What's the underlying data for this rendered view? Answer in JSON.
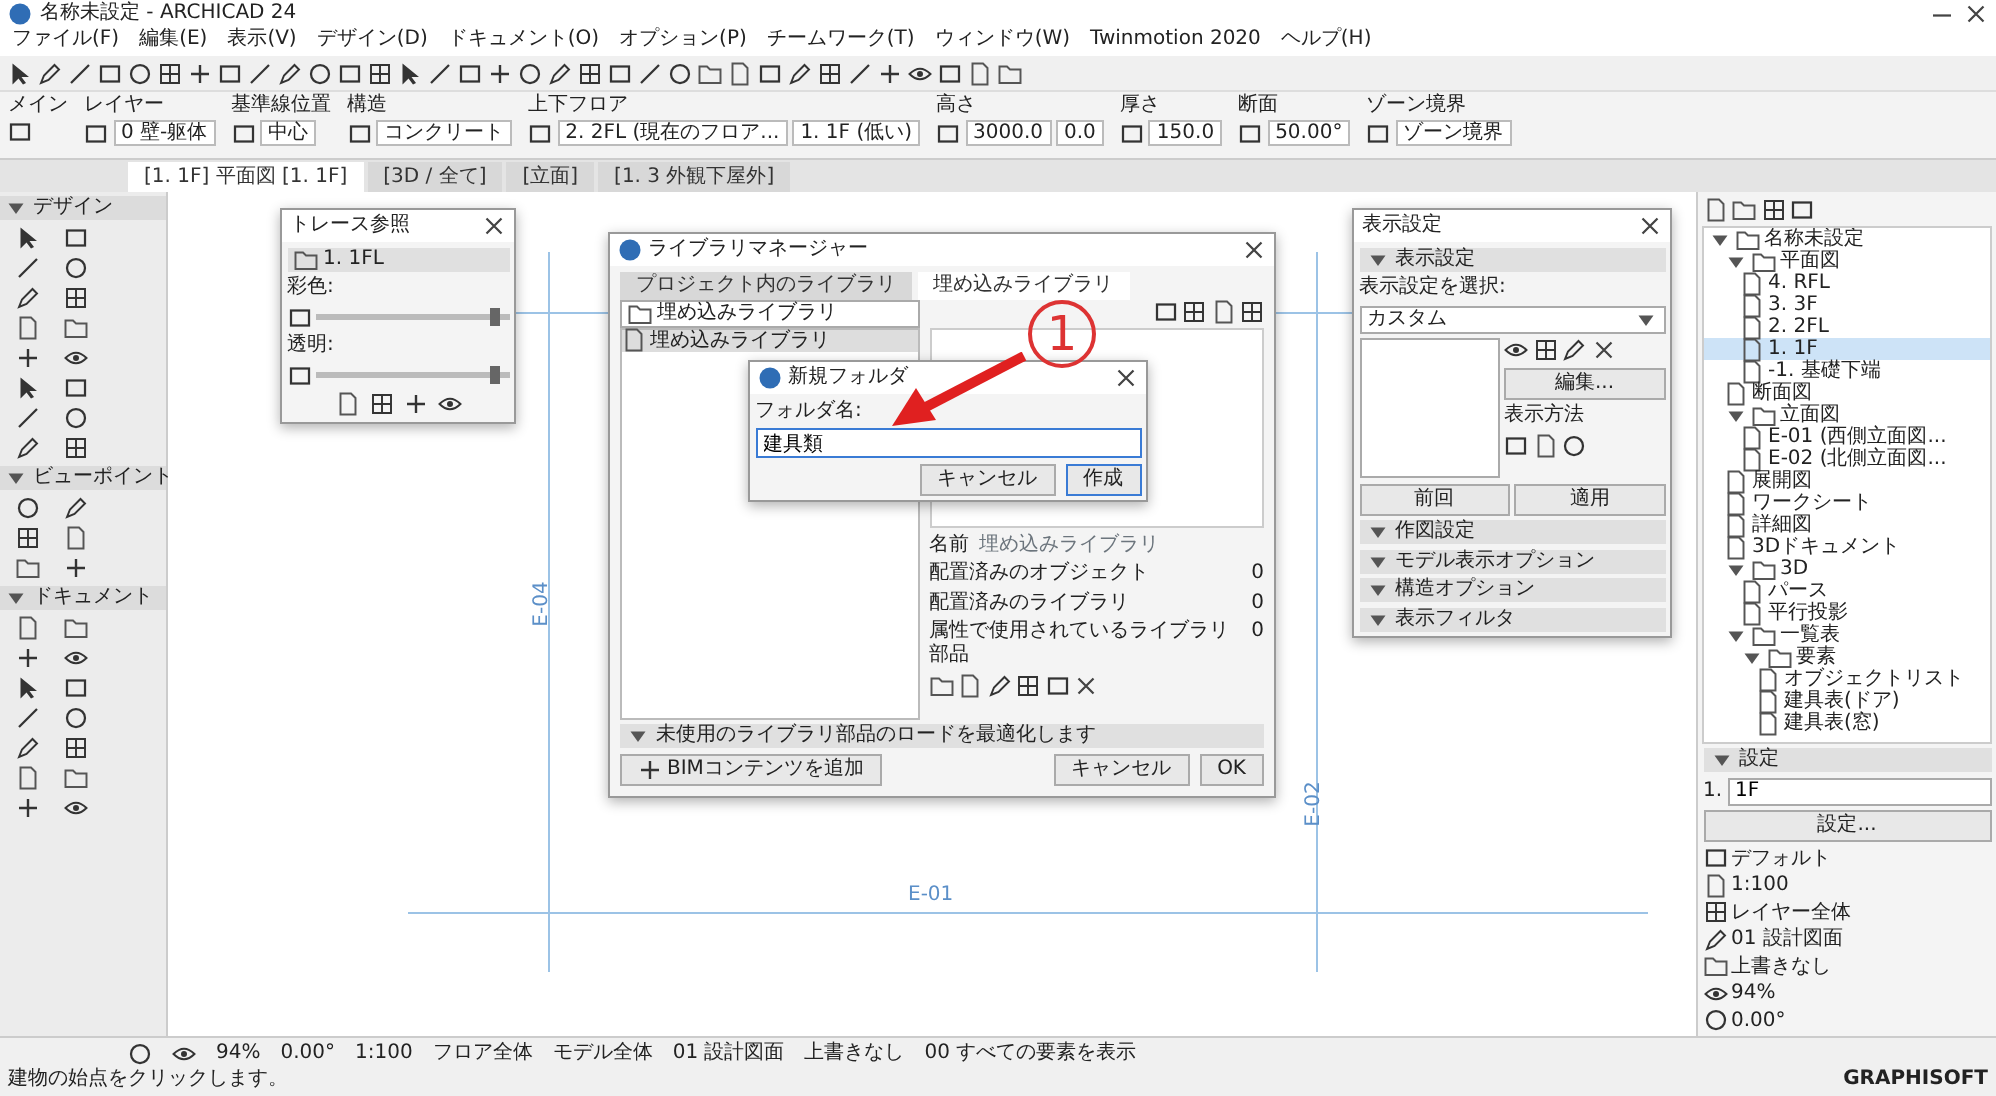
{
  "window": {
    "title": "名称未設定 - ARCHICAD 24"
  },
  "menu": [
    "ファイル(F)",
    "編集(E)",
    "表示(V)",
    "デザイン(D)",
    "ドキュメント(O)",
    "オプション(P)",
    "チームワーク(T)",
    "ウィンドウ(W)",
    "Twinmotion 2020",
    "ヘルプ(H)"
  ],
  "info_box": {
    "groups": [
      {
        "label": "メイン"
      },
      {
        "label": "レイヤー",
        "value": "0 壁-躯体"
      },
      {
        "label": "基準線位置",
        "value": "中心"
      },
      {
        "label": "構造",
        "value": "コンクリート"
      },
      {
        "label": "上下フロア",
        "value": "2. 2FL (現在のフロア...",
        "value_2": "1. 1F (低い)"
      },
      {
        "label": "高さ",
        "value": "3000.0",
        "value_2": "0.0"
      },
      {
        "label": "厚さ",
        "value": "150.0"
      },
      {
        "label": "断面",
        "value": "50.00°"
      },
      {
        "label": "ゾーン境界",
        "value": "ゾーン境界"
      }
    ]
  },
  "view_tabs": [
    {
      "label": "[1. 1F] 平面図 [1. 1F]",
      "selected": true
    },
    {
      "label": "[3D / 全て]",
      "selected": false
    },
    {
      "label": "[立面]",
      "selected": false
    },
    {
      "label": "[1. 3 外観下屋外]",
      "selected": false
    }
  ],
  "toolbox": {
    "sections": [
      {
        "label": "デザイン",
        "expanded": true
      },
      {
        "label": "ビューポイント",
        "expanded": true
      },
      {
        "label": "ドキュメント",
        "expanded": true
      }
    ]
  },
  "canvas": {
    "markers": [
      "E-04",
      "E-02",
      "E-01"
    ]
  },
  "trace_palette": {
    "title": "トレース参照",
    "source": "1. 1FL",
    "sliders": [
      {
        "label": "彩色:",
        "level": 0.92
      },
      {
        "label": "透明:",
        "level": 0.92
      }
    ]
  },
  "view_palette": {
    "title": "表示設定",
    "header": "表示設定",
    "select_label": "表示設定を選択:",
    "select_value": "カスタム",
    "edit_button": "編集...",
    "method_label": "表示方法",
    "buttons": [
      "前回",
      "適用"
    ],
    "sections": [
      "作図設定",
      "モデル表示オプション",
      "構造オプション",
      "表示フィルタ"
    ]
  },
  "library_manager": {
    "title": "ライブラリマネージャー",
    "tabs": [
      {
        "label": "プロジェクト内のライブラリ",
        "selected": false
      },
      {
        "label": "埋め込みライブラリ",
        "selected": true
      }
    ],
    "dropdown": "埋め込みライブラリ",
    "tree_item": "埋め込みライブラリ",
    "name_label": "名前",
    "name_value": "埋め込みライブラリ",
    "counts": [
      {
        "label": "配置済みのオブジェクト",
        "value": "0"
      },
      {
        "label": "配置済みのライブラリ",
        "value": "0"
      },
      {
        "label": "属性で使用されているライブラリ部品",
        "value": "0"
      }
    ],
    "optimize": "未使用のライブラリ部品のロードを最適化します",
    "add_button": "BIMコンテンツを追加",
    "cancel": "キャンセル",
    "ok": "OK"
  },
  "new_folder_dialog": {
    "title": "新規フォルダ",
    "field_label": "フォルダ名:",
    "field_value": "建具類",
    "cancel": "キャンセル",
    "create": "作成"
  },
  "annotation": {
    "number": "1"
  },
  "navigator": {
    "tree": [
      {
        "label": "名称未設定",
        "selected": false,
        "expanded": true,
        "children": [
          {
            "label": "平面図",
            "selected": false,
            "expanded": true,
            "children": [
              {
                "label": "4. RFL",
                "selected": false
              },
              {
                "label": "3. 3F",
                "selected": false
              },
              {
                "label": "2. 2FL",
                "selected": false
              },
              {
                "label": "1. 1F",
                "selected": true
              },
              {
                "label": "-1. 基礎下端",
                "selected": false
              }
            ]
          },
          {
            "label": "断面図",
            "selected": false
          },
          {
            "label": "立面図",
            "selected": false,
            "expanded": true,
            "children": [
              {
                "label": "E-01 (西側立面図...",
                "selected": false
              },
              {
                "label": "E-02 (北側立面図...",
                "selected": false
              }
            ]
          },
          {
            "label": "展開図",
            "selected": false
          },
          {
            "label": "ワークシート",
            "selected": false
          },
          {
            "label": "詳細図",
            "selected": false
          },
          {
            "label": "3Dドキュメント",
            "selected": false
          },
          {
            "label": "3D",
            "selected": false,
            "expanded": true,
            "children": [
              {
                "label": "パース",
                "selected": false
              },
              {
                "label": "平行投影",
                "selected": false
              }
            ]
          },
          {
            "label": "一覧表",
            "selected": false,
            "expanded": true,
            "children": [
              {
                "label": "要素",
                "selected": false,
                "expanded": true,
                "children": [
                  {
                    "label": "オブジェクトリスト",
                    "selected": false
                  },
                  {
                    "label": "建具表(ドア)",
                    "selected": false
                  },
                  {
                    "label": "建具表(窓)",
                    "selected": false
                  }
                ]
              }
            ]
          }
        ]
      }
    ]
  },
  "properties": {
    "header": "設定",
    "id": "1.",
    "field": "1F",
    "button": "設定...",
    "items": [
      "デフォルト",
      "1:100",
      "レイヤー全体",
      "01 設計図面",
      "上書きなし",
      "94%",
      "0.00°"
    ]
  },
  "status_bar": [
    "94%",
    "0.00°",
    "1:100",
    "フロア全体",
    "モデル全体",
    "01 設計図面",
    "上書きなし",
    "00 すべての要素を表示"
  ],
  "message": "建物の始点をクリックします。",
  "brand": "GRAPHISOFT"
}
